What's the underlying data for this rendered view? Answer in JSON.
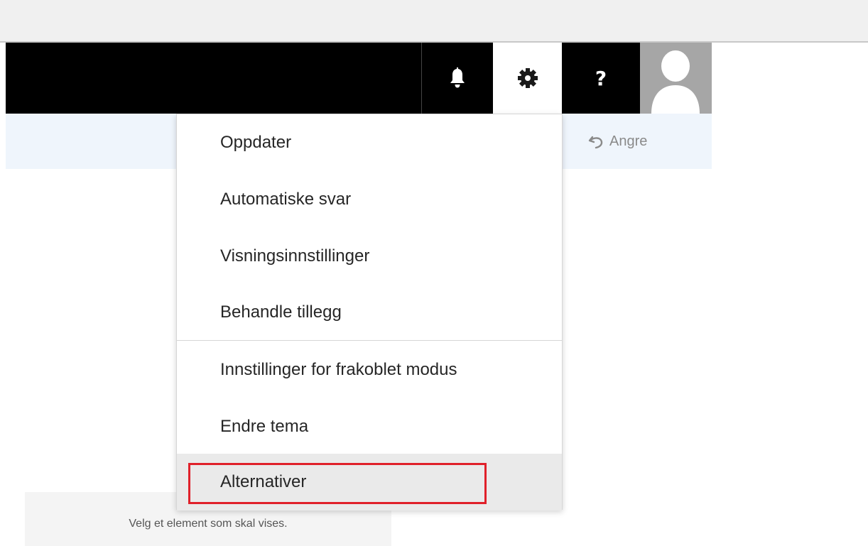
{
  "header": {
    "icons": {
      "notifications": "bell-icon",
      "settings": "gear-icon",
      "help": "question-icon",
      "profile": "avatar-icon"
    },
    "help_glyph": "?"
  },
  "command_bar": {
    "undo_label": "Angre",
    "undo_icon": "undo-icon"
  },
  "settings_menu": {
    "items": [
      {
        "label": "Oppdater"
      },
      {
        "label": "Automatiske svar"
      },
      {
        "label": "Visningsinnstillinger"
      },
      {
        "label": "Behandle tillegg"
      },
      {
        "label": "Innstillinger for frakoblet modus"
      },
      {
        "label": "Endre tema"
      },
      {
        "label": "Alternativer",
        "highlighted": true
      }
    ]
  },
  "reading_pane": {
    "message": "Velg et element som skal vises."
  },
  "colors": {
    "topbar": "#000000",
    "command_bar": "#eff5fc",
    "highlight_box": "#e0202a",
    "hover_item": "#eaeaea"
  }
}
